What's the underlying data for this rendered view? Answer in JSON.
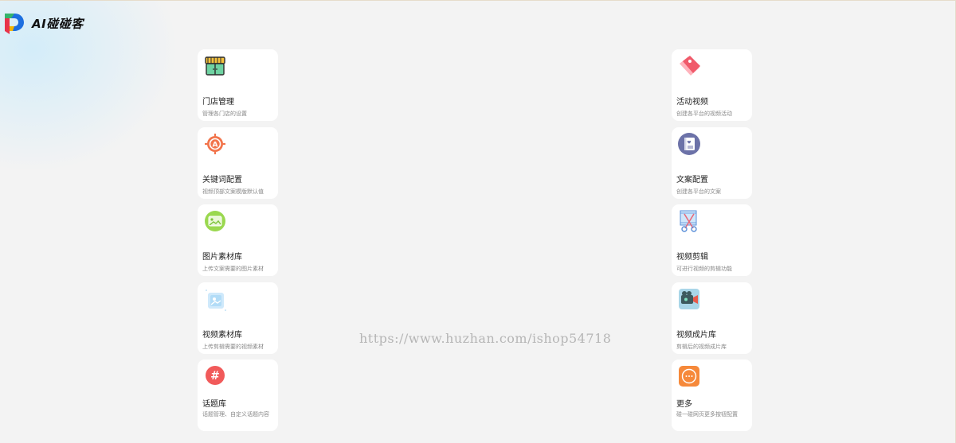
{
  "app": {
    "name": "AI碰碰客"
  },
  "left_cards": [
    {
      "title": "门店管理",
      "desc": "管理各门店的设置",
      "icon": "store-icon"
    },
    {
      "title": "关键词配置",
      "desc": "视频顶部文案模版默认值",
      "icon": "keyword-target-icon"
    },
    {
      "title": "图片素材库",
      "desc": "上传文案需要的图片素材",
      "icon": "image-library-icon"
    },
    {
      "title": "视频素材库",
      "desc": "上传剪辑需要的视频素材",
      "icon": "video-library-icon"
    },
    {
      "title": "话题库",
      "desc": "话题管理、自定义话题内容",
      "icon": "hashtag-icon"
    }
  ],
  "right_cards": [
    {
      "title": "活动视频",
      "desc": "创建各平台的视频活动",
      "icon": "tag-icon"
    },
    {
      "title": "文案配置",
      "desc": "创建各平台的文案",
      "icon": "notebook-icon"
    },
    {
      "title": "视频剪辑",
      "desc": "可进行视频的剪辑功能",
      "icon": "scissors-film-icon"
    },
    {
      "title": "视频成片库",
      "desc": "剪辑后的视频成片库",
      "icon": "video-camera-icon"
    },
    {
      "title": "更多",
      "desc": "碰一碰网页更多按钮配置",
      "icon": "more-icon"
    }
  ],
  "watermark": "https://www.huzhan.com/ishop54718",
  "colors": {
    "background": "#f3f3f3",
    "card": "#ffffff"
  }
}
